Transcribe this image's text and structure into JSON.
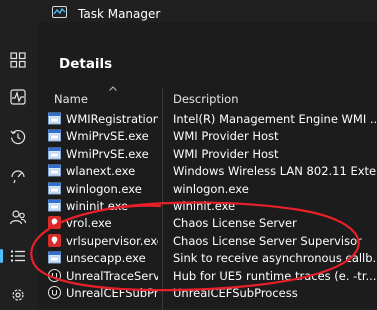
{
  "app": {
    "title": "Task Manager",
    "icon": "task-manager-icon"
  },
  "sidebar": {
    "items": [
      {
        "icon": "processes-grid-icon"
      },
      {
        "icon": "performance-pulse-icon"
      },
      {
        "icon": "app-history-icon"
      },
      {
        "icon": "startup-apps-icon"
      },
      {
        "icon": "users-icon"
      },
      {
        "icon": "details-list-icon",
        "active": true
      },
      {
        "icon": "services-gear-icon"
      }
    ]
  },
  "page": {
    "title": "Details"
  },
  "table": {
    "columns": [
      "Name",
      "Description"
    ],
    "rows": [
      {
        "name": "WMIRegistration...",
        "description": "Intel(R) Management Engine WMI ...",
        "icon": "exe-window-icon"
      },
      {
        "name": "WmiPrvSE.exe",
        "description": "WMI Provider Host",
        "icon": "exe-window-icon"
      },
      {
        "name": "WmiPrvSE.exe",
        "description": "WMI Provider Host",
        "icon": "exe-window-icon"
      },
      {
        "name": "wlanext.exe",
        "description": "Windows Wireless LAN 802.11 Exte...",
        "icon": "exe-window-icon"
      },
      {
        "name": "winlogon.exe",
        "description": "winlogon.exe",
        "icon": "exe-window-icon"
      },
      {
        "name": "wininit.exe",
        "description": "wininit.exe",
        "icon": "exe-window-icon"
      },
      {
        "name": "vrol.exe",
        "description": "Chaos License Server",
        "icon": "chaos-red-icon"
      },
      {
        "name": "vrlsupervisor.exe",
        "description": "Chaos License Server Supervisor",
        "icon": "chaos-red-icon"
      },
      {
        "name": "unsecapp.exe",
        "description": "Sink to receive asynchronous callb...",
        "icon": "exe-window-icon"
      },
      {
        "name": "UnrealTraceServe...",
        "description": "Hub for UE5 runtime traces (e.  -tr...",
        "icon": "unreal-icon"
      },
      {
        "name": "UnrealCEFSubPro...",
        "description": "UnrealCEFSubProcess",
        "icon": "unreal-icon"
      }
    ]
  },
  "colors": {
    "background": "#1c1c1c",
    "sidebar": "#202020",
    "accent": "#4cc2ff",
    "annotation": "#e8202a"
  }
}
